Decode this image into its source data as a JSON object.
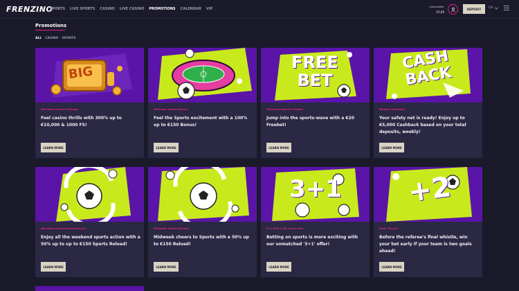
{
  "header": {
    "logo": "FRENZINO",
    "nav": [
      "SPORTS",
      "LIVE SPORTS",
      "CASINO",
      "LIVE CASINO",
      "PROMOTIONS",
      "CALENDAR",
      "VIP"
    ],
    "active_nav": "PROMOTIONS",
    "account_user": "CasinoJoker",
    "account_balance": "€5,00",
    "deposit_label": "DEPOSIT",
    "language": "EN"
  },
  "page": {
    "title": "Promotions",
    "filters": [
      "ALL",
      "CASINO",
      "SPORTS"
    ],
    "active_filter": "ALL"
  },
  "promotions": [
    {
      "tag": "Welcome Casino Package",
      "desc": "Feel casino thrills with 300% up to €10,000 & 1000 FS!",
      "button": "LEARN MORE",
      "art_text": "BIG"
    },
    {
      "tag": "Welcome Sports Bonus",
      "desc": "Feel the Sports excitement with a 100% up to €150 Bonus!",
      "button": "LEARN MORE",
      "art_text": ""
    },
    {
      "tag": "Welcome Sports Freebet",
      "desc": "Jump into the sports-wave with a €20 Freebet!",
      "button": "LEARN MORE",
      "art_text": "FREE BET"
    },
    {
      "tag": "Weekly Cashback",
      "desc": "Your safety net is ready! Enjoy up to €5,000 Cashback based on your total deposits, weekly!",
      "button": "LEARN MORE",
      "art_text": "CASH BACK"
    },
    {
      "tag": "Weekend Sports Reload Bonus",
      "desc": "Enjoy all the weekend sports action with a 50% up to up to €150 Sports Reload!",
      "button": "LEARN MORE",
      "art_text": ""
    },
    {
      "tag": "Midweek Sports Reload",
      "desc": "Midweek cheers to Sports with a 50% up to €150 Reload!",
      "button": "LEARN MORE",
      "art_text": ""
    },
    {
      "tag": "3+1 Every 4th bet is free",
      "desc": "Betting on sports is more exciting with our unmatched '3+1' offer!",
      "button": "LEARN MORE",
      "art_text": "3+1"
    },
    {
      "tag": "Early Payout",
      "desc": "Before the referee's final whistle, win your bet early if your team is two goals ahead!",
      "button": "LEARN MORE",
      "art_text": "+2"
    }
  ],
  "colors": {
    "background": "#1b1a2b",
    "card": "#2a2842",
    "accent": "#e0208e",
    "art_purple": "#5a14a8",
    "art_lime": "#c8ea1c",
    "button": "#d9d4c4"
  },
  "icons": {
    "avatar": "user-icon",
    "language": "chevron-down-icon",
    "menu": "menu-icon"
  }
}
